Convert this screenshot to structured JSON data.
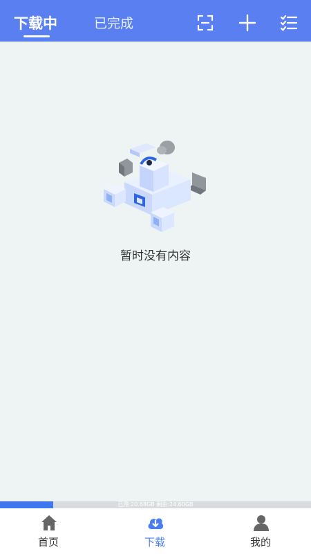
{
  "header": {
    "tabs": [
      {
        "label": "下载中",
        "active": true
      },
      {
        "label": "已完成",
        "active": false
      }
    ],
    "actions": [
      "scan-icon",
      "add-icon",
      "checklist-icon"
    ]
  },
  "empty_state": {
    "illustration": "empty-box-illustration",
    "message": "暂时没有内容"
  },
  "storage": {
    "text": "已用:20.68GB 剩余:24.60GB",
    "used_fraction": 0.17
  },
  "bottom_nav": {
    "items": [
      {
        "label": "首页",
        "icon": "home-icon",
        "active": false
      },
      {
        "label": "下载",
        "icon": "cloud-download-icon",
        "active": true
      },
      {
        "label": "我的",
        "icon": "user-icon",
        "active": false
      }
    ]
  },
  "colors": {
    "header": "#5a7ff0",
    "background": "#eef3f3",
    "accent": "#4a7ef0",
    "storage_fill": "#3f78ee",
    "storage_track": "#d9dcde"
  }
}
